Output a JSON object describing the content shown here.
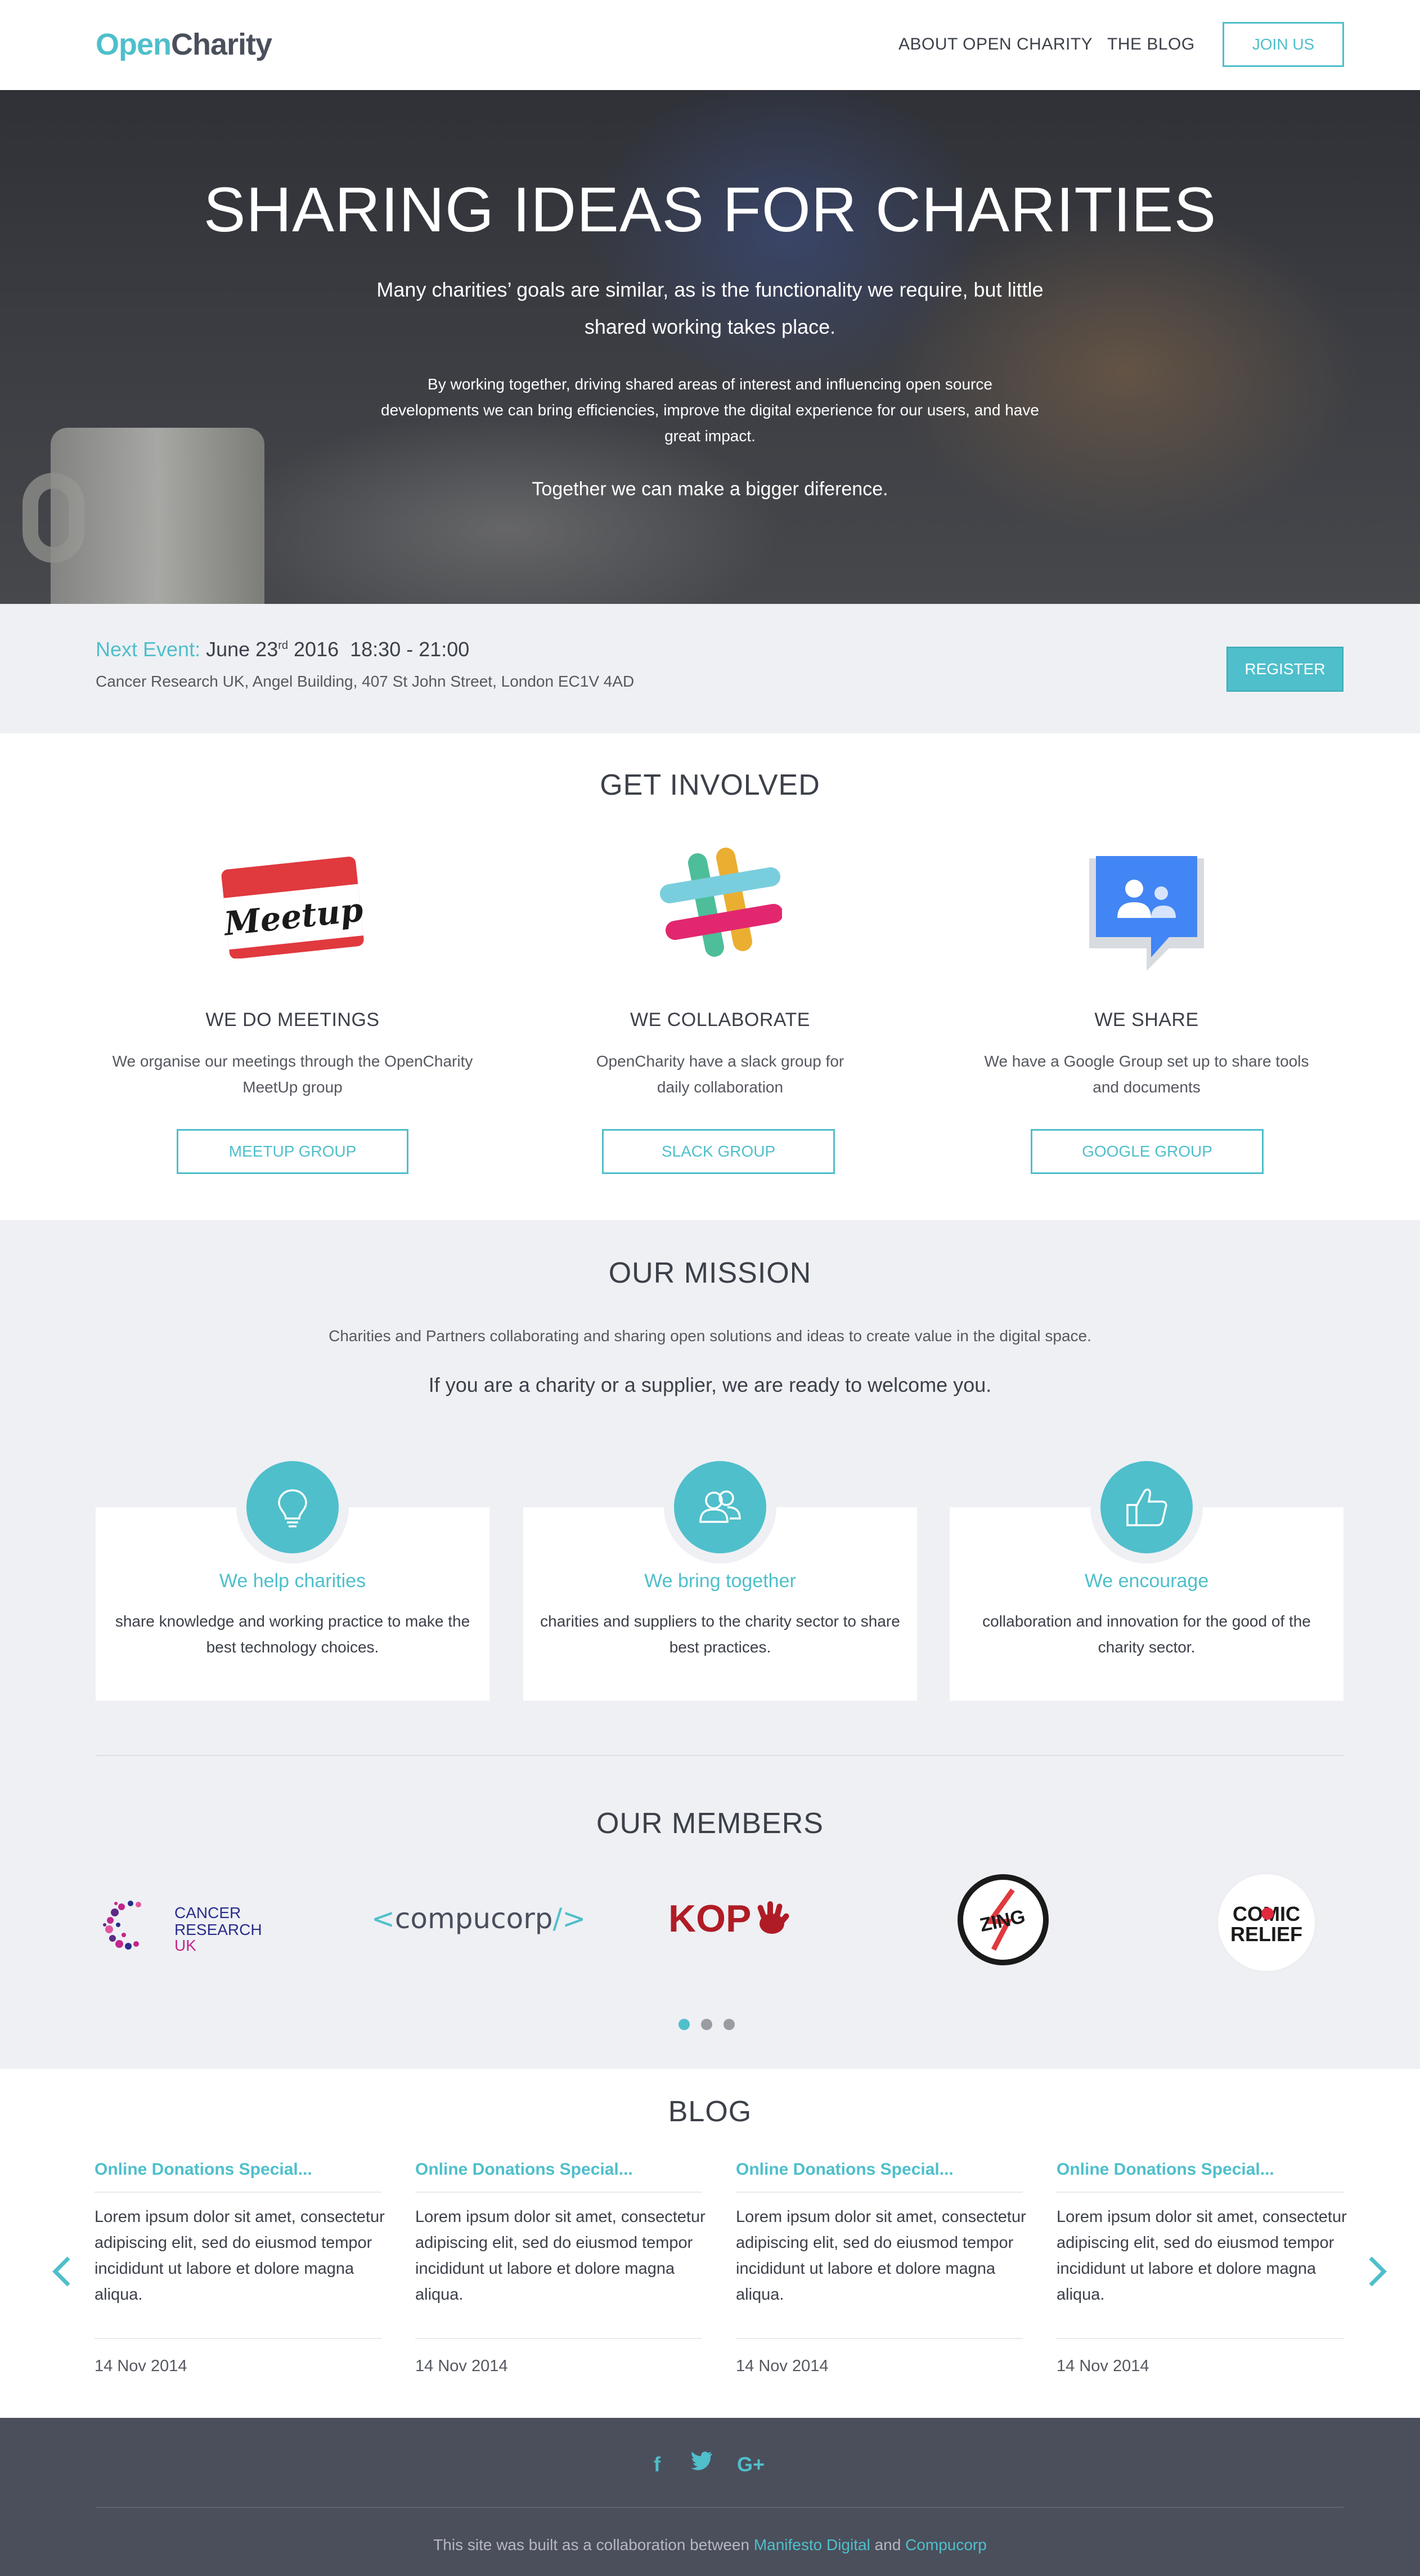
{
  "header": {
    "logo_part1": "Open",
    "logo_part2": "Charity",
    "nav": [
      "ABOUT OPEN CHARITY",
      "THE BLOG"
    ],
    "join_label": "JOIN US"
  },
  "hero": {
    "title": "SHARING IDEAS FOR CHARITIES",
    "lead": "Many charities’ goals are similar, as is the functionality we require, but little shared working takes place.",
    "body": "By working together, driving shared areas of interest and influencing open source developments we can bring efficiencies, improve the digital experience for our users, and have great impact.",
    "tagline": "Together we can make a bigger diference."
  },
  "event": {
    "label": "Next Event:",
    "date_day": "June 23",
    "date_suffix": "rd",
    "date_year": "2016",
    "time": "18:30 - 21:00",
    "location": "Cancer Research UK, Angel Building, 407 St John Street, London EC1V 4AD",
    "register_label": "REGISTER"
  },
  "involved": {
    "title": "GET INVOLVED",
    "items": [
      {
        "heading": "WE DO MEETINGS",
        "text": "We organise our meetings through the OpenCharity MeetUp group",
        "button": "MEETUP GROUP",
        "icon": "meetup-icon",
        "badge": "Meetup"
      },
      {
        "heading": "WE COLLABORATE",
        "text": "OpenCharity have a slack group for daily collaboration",
        "button": "SLACK GROUP",
        "icon": "slack-icon"
      },
      {
        "heading": "WE SHARE",
        "text": "We have a Google Group set up to share tools and documents",
        "button": "GOOGLE GROUP",
        "icon": "google-groups-icon"
      }
    ]
  },
  "mission": {
    "title": "OUR MISSION",
    "intro": "Charities and Partners collaborating and sharing open solutions and ideas to create value in the digital space.",
    "welcome": "If you are a charity or a supplier, we are ready to welcome you.",
    "cards": [
      {
        "heading": "We help charities",
        "text": "share knowledge and working practice to make the best technology choices.",
        "icon": "lightbulb-icon"
      },
      {
        "heading": "We bring together",
        "text": "charities and suppliers to the charity sector to share best practices.",
        "icon": "people-icon"
      },
      {
        "heading": "We encourage",
        "text": "collaboration and innovation for the good of the charity sector.",
        "icon": "thumbs-up-icon"
      }
    ]
  },
  "members": {
    "title": "OUR MEMBERS",
    "logos": [
      {
        "name": "cancer-research-uk-logo",
        "lines": [
          "CANCER",
          "RESEARCH",
          "UK"
        ]
      },
      {
        "name": "compucorp-logo",
        "text": "compucorp",
        "prefix": "<",
        "suffix": "/>"
      },
      {
        "name": "kop-logo",
        "text": "KOP"
      },
      {
        "name": "zing-logo",
        "text": "ZING"
      },
      {
        "name": "comic-relief-logo",
        "lines": [
          "COMIC",
          "RELIEF"
        ]
      }
    ],
    "carousel_pages": 3,
    "carousel_active": 1
  },
  "blog": {
    "title": "BLOG",
    "posts": [
      {
        "title": "Online Donations Special...",
        "excerpt": "Lorem ipsum dolor sit amet, consectetur adipiscing elit, sed do eiusmod tempor incididunt ut labore et dolore magna aliqua.",
        "date": "14 Nov 2014"
      },
      {
        "title": "Online Donations Special...",
        "excerpt": "Lorem ipsum dolor sit amet, consectetur adipiscing elit, sed do eiusmod tempor incididunt ut labore et dolore magna aliqua.",
        "date": "14 Nov 2014"
      },
      {
        "title": "Online Donations Special...",
        "excerpt": "Lorem ipsum dolor sit amet, consectetur adipiscing elit, sed do eiusmod tempor incididunt ut labore et dolore magna aliqua.",
        "date": "14 Nov 2014"
      },
      {
        "title": "Online Donations Special...",
        "excerpt": "Lorem ipsum dolor sit amet, consectetur adipiscing elit, sed do eiusmod tempor incididunt ut labore et dolore magna aliqua.",
        "date": "14 Nov 2014"
      }
    ],
    "prev_icon": "chevron-left-icon",
    "next_icon": "chevron-right-icon"
  },
  "footer": {
    "social": [
      {
        "name": "facebook-icon",
        "glyph": "f"
      },
      {
        "name": "twitter-icon",
        "glyph": "🐦"
      },
      {
        "name": "google-plus-icon",
        "glyph": "G+"
      }
    ],
    "credit_prefix": "This site was built as a collaboration between",
    "credit_link1": "Manifesto Digital",
    "credit_and": "and",
    "credit_link2": "Compucorp"
  },
  "colors": {
    "accent": "#4fbfcb",
    "dark_text": "#3c4049",
    "footer_bg": "#4b4f5c",
    "section_bg": "#eef0f4"
  }
}
